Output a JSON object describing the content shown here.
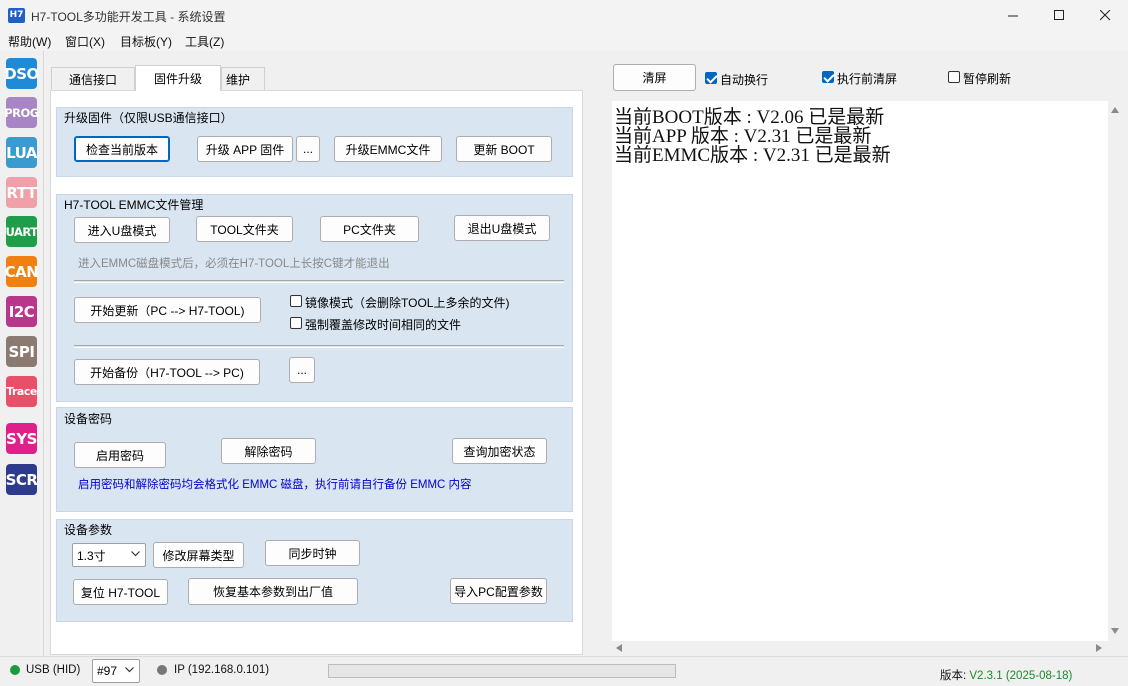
{
  "window": {
    "icon_text": "H7",
    "title": "H7-TOOL多功能开发工具 - 系统设置"
  },
  "menu": [
    "帮助(W)",
    "窗口(X)",
    "目标板(Y)",
    "工具(Z)"
  ],
  "sidebar": [
    {
      "label": "DSO",
      "color": "#1f8bd6"
    },
    {
      "label": "PROG",
      "color": "#a886c6"
    },
    {
      "label": "LUA",
      "color": "#3a9bd0"
    },
    {
      "label": "RTT",
      "color": "#f0a0a8"
    },
    {
      "label": "UART",
      "color": "#1f9e4a"
    },
    {
      "label": "CAN",
      "color": "#f08010"
    },
    {
      "label": "I2C",
      "color": "#b8378b"
    },
    {
      "label": "SPI",
      "color": "#8a7a72"
    },
    {
      "label": "Trace",
      "color": "#e8506a"
    },
    {
      "label": "SYS",
      "color": "#e0208a"
    },
    {
      "label": "SCR",
      "color": "#2e3a8c"
    }
  ],
  "tabs": [
    "通信接口",
    "固件升级",
    "维护"
  ],
  "upgrade": {
    "title": "升级固件（仅限USB通信接口）",
    "check_version": "检查当前版本",
    "upgrade_app": "升级 APP 固件",
    "browse": "...",
    "upgrade_emmc": "升级EMMC文件",
    "update_boot": "更新 BOOT"
  },
  "emmc": {
    "title": "H7-TOOL EMMC文件管理",
    "enter_udisk": "进入U盘模式",
    "tool_folder": "TOOL文件夹",
    "pc_folder": "PC文件夹",
    "exit_udisk": "退出U盘模式",
    "hint": "进入EMMC磁盘模式后，必须在H7-TOOL上长按C键才能退出",
    "start_update": "开始更新（PC --> H7-TOOL)",
    "mirror_mode": "镜像模式（会删除TOOL上多余的文件)",
    "force_overwrite": "强制覆盖修改时间相同的文件",
    "start_backup": "开始备份（H7-TOOL --> PC)",
    "browse": "..."
  },
  "password": {
    "title": "设备密码",
    "enable": "启用密码",
    "remove": "解除密码",
    "query": "查询加密状态",
    "note": "启用密码和解除密码均会格式化 EMMC 磁盘，执行前请自行备份 EMMC 内容"
  },
  "params": {
    "title": "设备参数",
    "screen_size": "1.3寸",
    "modify_screen": "修改屏幕类型",
    "sync_clock": "同步时钟",
    "reset": "复位 H7-TOOL",
    "restore_defaults": "恢复基本参数到出厂值",
    "import_pc_config": "导入PC配置参数"
  },
  "log_toolbar": {
    "clear": "清屏",
    "auto_wrap": "自动换行",
    "auto_wrap_checked": true,
    "clear_before_exec": "执行前清屏",
    "clear_before_exec_checked": true,
    "pause_refresh": "暂停刷新",
    "pause_refresh_checked": false
  },
  "log_lines": [
    "当前BOOT版本 : V2.06 已是最新",
    "当前APP 版本 : V2.31 已是最新",
    "当前EMMC版本 : V2.31 已是最新"
  ],
  "status": {
    "usb": "USB (HID)",
    "usb_color": "#1a9c3a",
    "device": "#97",
    "ip": "IP (192.168.0.101)",
    "ip_color": "#777777",
    "version_label": "版本: ",
    "version_value": "V2.3.1 (2025-08-18)",
    "version_color": "#1a8a2a"
  }
}
